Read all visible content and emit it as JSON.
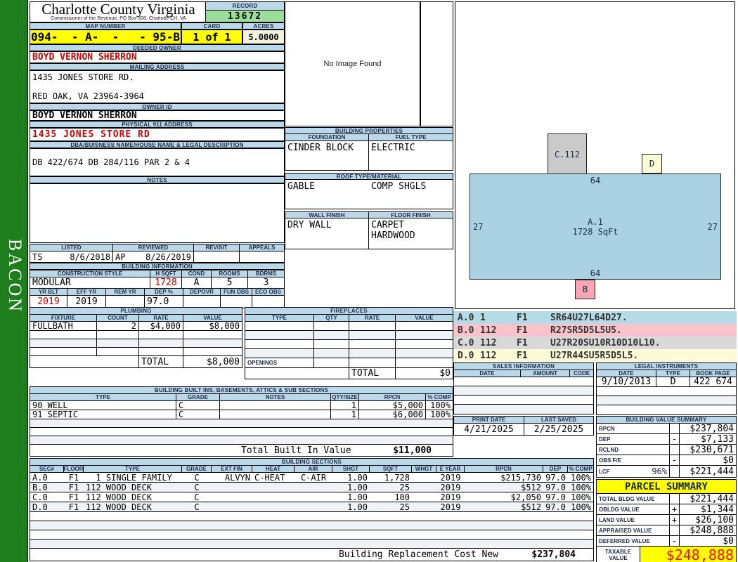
{
  "sidebar": {
    "label": "BACON"
  },
  "header": {
    "county": "Charlotte County Virginia",
    "commissioner": "Commissioner of the Revenue, PO Box 308, Charlotte CH, VA",
    "record_label": "RECORD",
    "record_value": "13672",
    "map_number_label": "MAP NUMBER",
    "map_number": "094-  - A-  -   - 95-B",
    "card_label": "CARD",
    "card": "1 of 1",
    "acres_label": "ACRES",
    "acres": "5.0000",
    "accent_yellow": "#ffff00",
    "accent_green": "#9ade9a",
    "accent_blue": "#b9d9ea"
  },
  "owner": {
    "deeded_owner_label": "DEEDED OWNER",
    "deeded_owner": "BOYD VERNON SHERRON",
    "mailing_address_label": "MAILING ADDRESS",
    "mailing_line1": "1435 JONES STORE RD.",
    "mailing_line2": "RED OAK, VA 23964-3964",
    "owner_id_label": "OWNER ID",
    "owner_id": "BOYD VERNON SHERRON",
    "physical_label": "PHYSICAL 911 ADDRESS",
    "physical_address": "1435 JONES STORE RD",
    "dba_label": "DBA/BUISNESS NAME/HOUSE NAME & LEGAL DESCRIPTION",
    "dba": "DB 422/674 DB 284/116 PAR 2 & 4",
    "notes_label": "NOTES",
    "notes": ""
  },
  "review": {
    "listed_label": "LISTED",
    "reviewed_label": "REVIEWED",
    "revisit_label": "REVISIT",
    "appeals_label": "APPEALS",
    "listed_by": "TS",
    "listed_date": "8/6/2018",
    "reviewed_by": "AP",
    "reviewed_date": "8/26/2019",
    "revisit": "",
    "appeals": ""
  },
  "building_information": {
    "title": "BUILDING INFORMATION",
    "style_label": "CONSTRUCTION STYLE",
    "hsqft_label": "H SQFT",
    "cond_label": "COND",
    "rooms_label": "ROOMS",
    "bdrms_label": "BDRMS",
    "style": "MODULAR",
    "hsqft": "1728",
    "cond": "A",
    "rooms": "5",
    "bdrms": "3",
    "yrblt_label": "YR BLT",
    "effyr_label": "EFF YR",
    "remyr_label": "REM YR",
    "dep_label": "DEP %",
    "depovr_label": "DEPOVR",
    "funobs_label": "FUN OBS",
    "ecoobs_label": "ECO OBS",
    "yrblt": "2019",
    "effyr": "2019",
    "remyr": "",
    "dep": "97.0",
    "depovr": "",
    "funobs": "",
    "ecoobs": ""
  },
  "photo": {
    "placeholder": "No Image Found"
  },
  "building_properties": {
    "title": "BUILDING PROPERTIES",
    "foundation_label": "FOUNDATION",
    "fuel_label": "FUEL TYPE",
    "foundation": "CINDER BLOCK",
    "fuel": "ELECTRIC",
    "roof_label": "ROOF TYPE/MATERIAL",
    "roof_type": "GABLE",
    "roof_material": "COMP SHGLS",
    "wall_label": "WALL FINISH",
    "floor_label": "FLOOR FINISH",
    "wall": "DRY WALL",
    "floor1": "CARPET",
    "floor2": "HARDWOOD"
  },
  "plumbing": {
    "title": "PLUMBING",
    "fixture_label": "FIXTURE",
    "count_label": "COUNT",
    "rate_label": "RATE",
    "value_label": "VALUE",
    "rows": [
      {
        "fixture": "FULLBATH",
        "count": "2",
        "rate": "$4,000",
        "value": "$8,000"
      }
    ],
    "total_label": "TOTAL",
    "total": "$8,000"
  },
  "fireplaces": {
    "title": "FIREPLACES",
    "type_label": "TYPE",
    "qty_label": "QTY",
    "rate_label": "RATE",
    "value_label": "VALUE",
    "openings_label": "OPENINGS",
    "total_label": "TOTAL",
    "total": "$0"
  },
  "built_ins": {
    "title": "BUILDING BUILT INS, BASEMENTS, ATTICS & SUB SECTIONS",
    "type_label": "TYPE",
    "grade_label": "GRADE",
    "notes_label": "NOTES",
    "qty_label": "QTY/SIZE",
    "rpcn_label": "RPCN",
    "comp_label": "% COMP",
    "rows": [
      {
        "type": "90 WELL",
        "grade": "C",
        "notes": "",
        "qty": "1",
        "rpcn": "$5,000",
        "comp": "100%"
      },
      {
        "type": "91 SEPTIC",
        "grade": "C",
        "notes": "",
        "qty": "1",
        "rpcn": "$6,000",
        "comp": "100%"
      }
    ],
    "total_label": "Total Built In Value",
    "total": "$11,000"
  },
  "building_sections": {
    "title": "BUILDING SECTIONS",
    "headers": [
      "SEC#",
      "FLOOR",
      "TYPE",
      "GRADE",
      "EXT FIN",
      "HEAT",
      "AIR",
      "SHGT",
      "SQFT",
      "WHGT",
      "E YEAR",
      "RPCN",
      "DEP",
      "% COMP"
    ],
    "rows": [
      {
        "sec": "A.0",
        "floor": "F1",
        "type": "  1 SINGLE FAMILY",
        "grade": "C",
        "extfin": "ALVYN",
        "heat": "C-HEAT",
        "air": "C-AIR",
        "shgt": "1.00",
        "sqft": "1,728",
        "whgt": "",
        "eyear": "2019",
        "rpcn": "$215,730",
        "dep": "97.0",
        "comp": "100%"
      },
      {
        "sec": "B.0",
        "floor": "F1",
        "type": "112 WOOD DECK",
        "grade": "C",
        "extfin": "",
        "heat": "",
        "air": "",
        "shgt": "1.00",
        "sqft": "25",
        "whgt": "",
        "eyear": "2019",
        "rpcn": "$512",
        "dep": "97.0",
        "comp": "100%"
      },
      {
        "sec": "C.0",
        "floor": "F1",
        "type": "112 WOOD DECK",
        "grade": "C",
        "extfin": "",
        "heat": "",
        "air": "",
        "shgt": "1.00",
        "sqft": "100",
        "whgt": "",
        "eyear": "2019",
        "rpcn": "$2,050",
        "dep": "97.0",
        "comp": "100%"
      },
      {
        "sec": "D.0",
        "floor": "F1",
        "type": "112 WOOD DECK",
        "grade": "C",
        "extfin": "",
        "heat": "",
        "air": "",
        "shgt": "1.00",
        "sqft": "25",
        "whgt": "",
        "eyear": "2019",
        "rpcn": "$512",
        "dep": "97.0",
        "comp": "100%"
      }
    ],
    "replacement_label": "Building Replacement Cost New",
    "replacement_value": "$237,804"
  },
  "sketch": {
    "main_label": "A.1",
    "main_sqft": "1728 SqFt",
    "dim_top": "64",
    "dim_bottom": "64",
    "dim_left": "27",
    "dim_right": "27",
    "c_label": "C.112",
    "d_label": "D",
    "b_label": "B",
    "colors": {
      "a": "#abd2e2",
      "b": "#f7a6b4",
      "c": "#cbcbcb",
      "d": "#fbfbd8"
    }
  },
  "vectors": {
    "rows": [
      {
        "sec": "A.0",
        "code": "1",
        "floor": "F1",
        "trace": "SR64U27L64D27.",
        "color": "#b5dbe9"
      },
      {
        "sec": "B.0",
        "code": "112",
        "floor": "F1",
        "trace": "R27SR5D5L5U5.",
        "color": "#f9c3cb"
      },
      {
        "sec": "C.0",
        "code": "112",
        "floor": "F1",
        "trace": "U27R20SU10R10D10L10.",
        "color": "#d9d9d9"
      },
      {
        "sec": "D.0",
        "code": "112",
        "floor": "F1",
        "trace": "U27R44SU5R5D5L5.",
        "color": "#fbfbd8"
      }
    ]
  },
  "sales": {
    "title": "SALES INFORMATION",
    "date_label": "DATE",
    "amount_label": "AMOUNT",
    "code_label": "CODE"
  },
  "legal": {
    "title": "LEGAL INSTRUMENTS",
    "date_label": "DATE",
    "type_label": "TYPE",
    "book_label": "BOOK PAGE",
    "rows": [
      {
        "date": "9/10/2013",
        "type": "D",
        "book_page": "422 674"
      }
    ]
  },
  "dates": {
    "print_label": "PRINT DATE",
    "print": "4/21/2025",
    "saved_label": "LAST SAVED",
    "saved": "2/25/2025"
  },
  "value_summary": {
    "title": "BUILDING VALUE SUMMARY",
    "rows": [
      {
        "label": "RPCN",
        "pct": "",
        "op": "",
        "amount": "$237,804"
      },
      {
        "label": "DEP",
        "pct": "",
        "op": "-",
        "amount": "$7,133"
      },
      {
        "label": "RCLND",
        "pct": "",
        "op": "",
        "amount": "$230,671"
      },
      {
        "label": "OBS F/E",
        "pct": "",
        "op": "-",
        "amount": "$0"
      },
      {
        "label": "LCF",
        "pct": "96%",
        "op": "",
        "amount": "$221,444"
      }
    ]
  },
  "parcel_summary": {
    "title": "PARCEL SUMMARY",
    "rows": [
      {
        "label": "TOTAL BLDG VALUE",
        "op": "",
        "amount": "$221,444"
      },
      {
        "label": "OBLDG VALUE",
        "op": "+",
        "amount": "$1,344"
      },
      {
        "label": "LAND VALUE",
        "op": "+",
        "amount": "$26,100"
      },
      {
        "label": "APPRAISED VALUE",
        "op": "",
        "amount": "$248,888"
      },
      {
        "label": "DEFERRED VALUE",
        "op": "-",
        "amount": "$0"
      }
    ],
    "taxable_label": "TAXABLE VALUE",
    "taxable": "$248,888",
    "taxable_color": "#ee1111"
  }
}
